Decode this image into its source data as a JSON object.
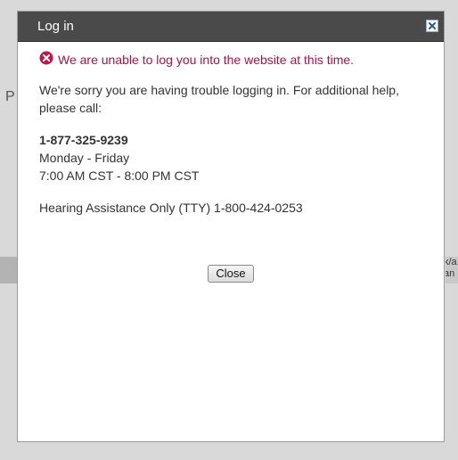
{
  "background": {
    "left_text": "P",
    "right_text_line1": "k/a",
    "right_text_line2": "an"
  },
  "dialog": {
    "title": "Log in",
    "close_icon": "close-x-icon",
    "error_icon": "error-circle-icon",
    "error_message": "We are unable to log you into the website at this time.",
    "message_line1": "We're sorry you are having trouble logging in. For additional help,",
    "message_line2": "please call:",
    "phone": "1-877-325-9239",
    "days": "Monday - Friday",
    "hours": "7:00 AM CST - 8:00 PM CST",
    "tty": "Hearing Assistance Only (TTY) 1-800-424-0253",
    "close_label": "Close"
  },
  "colors": {
    "titlebar": "#4a4a4a",
    "error_text": "#a0154b",
    "error_icon": "#c0174a"
  }
}
